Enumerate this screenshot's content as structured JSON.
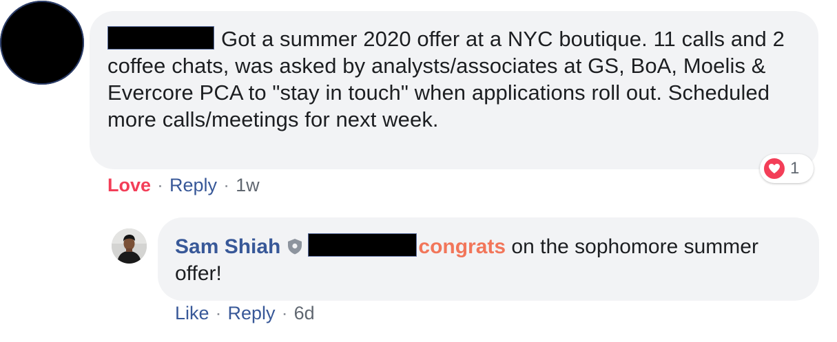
{
  "comment": {
    "text": "Got a summer 2020 offer at a NYC boutique. 11 calls and 2 coffee chats, was asked by analysts/associates at GS, BoA, Moelis & Evercore PCA to \"stay in touch\" when applications roll out. Scheduled more calls/meetings for next week.",
    "reaction_icon": "heart-icon",
    "reaction_count": "1",
    "actions": {
      "love_label": "Love",
      "reply_label": "Reply",
      "separator": "·",
      "timestamp": "1w"
    }
  },
  "reply": {
    "author_name": "Sam Shiah",
    "badge_icon": "shield-icon",
    "mention_text": "congrats",
    "text": " on the sophomore summer offer!",
    "actions": {
      "like_label": "Like",
      "reply_label": "Reply",
      "separator": "·",
      "timestamp": "6d"
    }
  },
  "colors": {
    "bubble_bg": "#f2f3f5",
    "link_blue": "#385898",
    "love_red": "#f33e58",
    "mention_orange": "#f2765a",
    "meta_gray": "#606770"
  }
}
